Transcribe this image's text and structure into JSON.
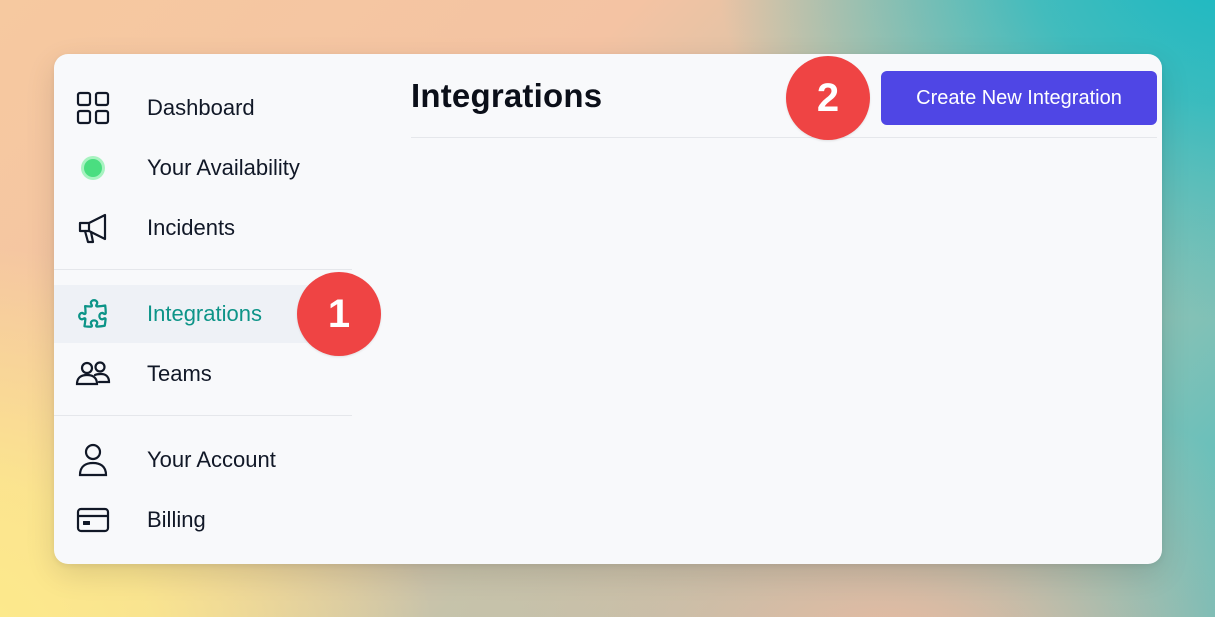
{
  "sidebar": {
    "items": [
      {
        "label": "Dashboard",
        "icon": "dashboard-grid-icon",
        "active": false
      },
      {
        "label": "Your Availability",
        "icon": "availability-status-dot-icon",
        "active": false
      },
      {
        "label": "Incidents",
        "icon": "megaphone-icon",
        "active": false
      },
      {
        "label": "Integrations",
        "icon": "puzzle-piece-icon",
        "active": true
      },
      {
        "label": "Teams",
        "icon": "users-group-icon",
        "active": false
      },
      {
        "label": "Your Account",
        "icon": "user-icon",
        "active": false
      },
      {
        "label": "Billing",
        "icon": "credit-card-icon",
        "active": false
      }
    ]
  },
  "main": {
    "title": "Integrations",
    "create_button_label": "Create New Integration"
  },
  "annotations": {
    "step_1": "1",
    "step_2": "2"
  },
  "colors": {
    "accent": "#4f46e5",
    "active_nav": "#0d9488",
    "availability_dot": "#4ade80",
    "annotation_badge": "#ef4444"
  }
}
